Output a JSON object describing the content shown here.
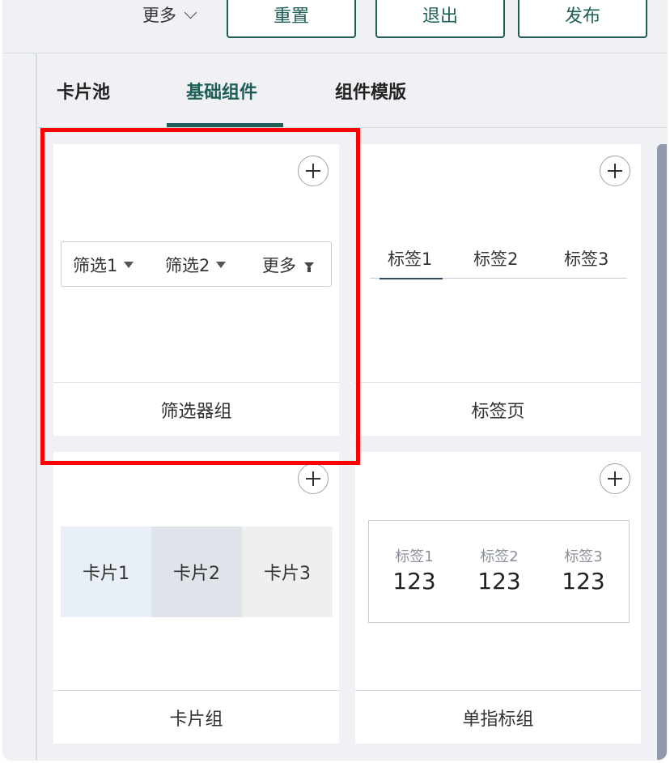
{
  "toolbar": {
    "more_label": "更多",
    "reset_label": "重置",
    "exit_label": "退出",
    "publish_label": "发布"
  },
  "tabs": {
    "card_pool": "卡片池",
    "basic_components": "基础组件",
    "component_templates": "组件模版",
    "active": "基础组件"
  },
  "components": [
    {
      "name": "筛选器组",
      "preview": {
        "filters": [
          "筛选1",
          "筛选2",
          "更多"
        ]
      }
    },
    {
      "name": "标签页",
      "preview": {
        "tabs": [
          "标签1",
          "标签2",
          "标签3"
        ]
      }
    },
    {
      "name": "卡片组",
      "preview": {
        "cards": [
          "卡片1",
          "卡片2",
          "卡片3"
        ]
      }
    },
    {
      "name": "单指标组",
      "preview": {
        "indicators": [
          {
            "label": "标签1",
            "value": "123"
          },
          {
            "label": "标签2",
            "value": "123"
          },
          {
            "label": "标签3",
            "value": "123"
          }
        ]
      }
    }
  ],
  "colors": {
    "accent": "#1e5e57",
    "highlight": "#ff0000",
    "scrollbar": "#8e9aab",
    "card1_bg": "#e9eff7",
    "card2_bg": "#dfe3ea",
    "card3_bg": "#efefef"
  },
  "icons": {
    "more_dropdown": "chevron-down-icon",
    "add": "plus-circle-icon",
    "filter_dropdown": "caret-down-icon",
    "filter_more": "funnel-icon"
  }
}
